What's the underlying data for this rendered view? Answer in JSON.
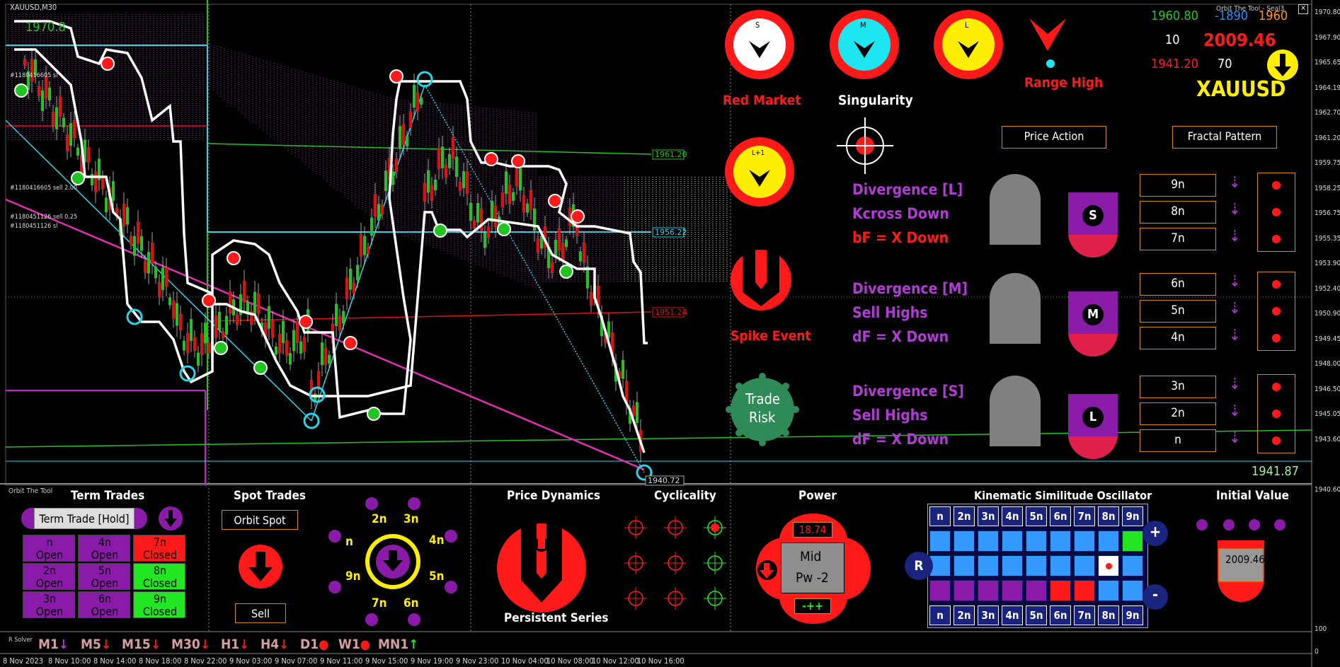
{
  "symbol": "XAUUSD,M30",
  "top_left_price": "1970.8",
  "tool_title": "Orbit The Tool - Seal3",
  "panel_title": "Orbit The Tool",
  "solver_label": "R Solver",
  "chart_labels": {
    "sl1": "#1180416605 sl",
    "sell1": "#1180416605 sell 2.00",
    "sell2": "#1180451126 sell 0.25",
    "sl2": "#1180451126 sl"
  },
  "level_tags": {
    "green": "1961.20",
    "cyan": "1956.22",
    "red": "1951.24",
    "bottom": "1940.72"
  },
  "price_current": "1941.87",
  "price_axis": [
    "1970.80",
    "1967.90",
    "1965.65",
    "1964.19",
    "1962.70",
    "1961.20",
    "1959.75",
    "1958.25",
    "1956.75",
    "1955.35",
    "1953.90",
    "1952.40",
    "1950.90",
    "1949.45",
    "1948.00",
    "1946.50",
    "1945.05",
    "1943.60",
    "1941.87",
    "1940.60"
  ],
  "time_axis": [
    "8 Nov 2023",
    "8 Nov 10:00",
    "8 Nov 14:00",
    "8 Nov 18:00",
    "8 Nov 22:00",
    "9 Nov 03:00",
    "9 Nov 07:00",
    "9 Nov 11:00",
    "9 Nov 15:00",
    "9 Nov 19:00",
    "9 Nov 23:00",
    "10 Nov 04:00",
    "10 Nov 08:00",
    "10 Nov 12:00",
    "10 Nov 16:00"
  ],
  "dials": {
    "s": "S",
    "m": "M",
    "l": "L",
    "l1": "L+1"
  },
  "labels": {
    "red_market": "Red Market",
    "singularity": "Singularity",
    "range_high": "Range High",
    "spike_event": "Spike Event",
    "trade_risk": [
      "Trade",
      "Risk"
    ]
  },
  "stats": {
    "green": "1960.80",
    "blue": "-1890",
    "orange": "1960",
    "white_left": "10",
    "big_red": "2009.46",
    "red_small": "1941.20",
    "white_right": "70",
    "symbol_big": "XAUUSD"
  },
  "buttons": {
    "price_action": "Price Action",
    "fractal_pattern": "Fractal Pattern"
  },
  "divergences": [
    {
      "lines": [
        "Divergence [L]",
        "Kcross Down",
        "bF = X Down"
      ],
      "colors": [
        "#b23bd6",
        "#b23bd6",
        "#ff1a1a"
      ],
      "letter": "S",
      "n": [
        "9n",
        "8n",
        "7n"
      ]
    },
    {
      "lines": [
        "Divergence [M]",
        "Sell Highs",
        "dF = X Down"
      ],
      "colors": [
        "#b23bd6",
        "#b23bd6",
        "#b23bd6"
      ],
      "letter": "M",
      "n": [
        "6n",
        "5n",
        "4n"
      ]
    },
    {
      "lines": [
        "Divergence [S]",
        "Sell Highs",
        "dF = X Down"
      ],
      "colors": [
        "#b23bd6",
        "#b23bd6",
        "#b23bd6"
      ],
      "letter": "L",
      "n": [
        "3n",
        "2n",
        "n"
      ]
    }
  ],
  "bottom": {
    "term_trades": "Term Trades",
    "term_hold": "Term Trade [Hold]",
    "grid": [
      {
        "n": "n",
        "s": "Open",
        "c": "#8a1aa8"
      },
      {
        "n": "4n",
        "s": "Open",
        "c": "#8a1aa8"
      },
      {
        "n": "7n",
        "s": "Closed",
        "c": "#ff1a1a"
      },
      {
        "n": "2n",
        "s": "Open",
        "c": "#8a1aa8"
      },
      {
        "n": "5n",
        "s": "Open",
        "c": "#8a1aa8"
      },
      {
        "n": "8n",
        "s": "Closed",
        "c": "#22e622"
      },
      {
        "n": "3n",
        "s": "Open",
        "c": "#8a1aa8"
      },
      {
        "n": "6n",
        "s": "Open",
        "c": "#8a1aa8"
      },
      {
        "n": "9n",
        "s": "Closed",
        "c": "#22e622"
      }
    ],
    "spot_trades": "Spot Trades",
    "orbit_spot": "Orbit Spot",
    "sell": "Sell",
    "orbit_labels": {
      "n": "n",
      "2n": "2n",
      "3n": "3n",
      "4n": "4n",
      "5n": "5n",
      "6n": "6n",
      "7n": "7n",
      "9n": "9n"
    },
    "price_dynamics": "Price Dynamics",
    "persistent_series": "Persistent Series",
    "cyclicality": "Cyclicality",
    "power": "Power",
    "power_value": "18.74",
    "power_mid": "Mid",
    "power_pw": "Pw -2",
    "power_signs": "-++",
    "kso": "Kinematic Similitude Oscillator",
    "kso_cols": [
      "n",
      "2n",
      "3n",
      "4n",
      "5n",
      "6n",
      "7n",
      "8n",
      "9n"
    ],
    "kso_r": "R",
    "kso_plus": "+",
    "kso_minus": "-",
    "initial_value": "Initial Value",
    "initial_value_num": "2009.46"
  },
  "timeframes": [
    {
      "label": "M1",
      "arrow": "↓",
      "ac": "#b23bd6"
    },
    {
      "label": "M5",
      "arrow": "↓",
      "ac": "#ff1a1a"
    },
    {
      "label": "M15",
      "arrow": "↓",
      "ac": "#ff1a1a"
    },
    {
      "label": "M30",
      "arrow": "↓",
      "ac": "#ff1a1a"
    },
    {
      "label": "H1",
      "arrow": "↓",
      "ac": "#ff1a1a"
    },
    {
      "label": "H4",
      "arrow": "↓",
      "ac": "#ff1a1a"
    },
    {
      "label": "D1",
      "arrow": "●",
      "ac": "#ff1a1a"
    },
    {
      "label": "W1",
      "arrow": "●",
      "ac": "#ff1a1a"
    },
    {
      "label": "MN1",
      "arrow": "↑",
      "ac": "#22e622"
    }
  ],
  "osc_axis": {
    "top": "100",
    "bottom": "0"
  }
}
